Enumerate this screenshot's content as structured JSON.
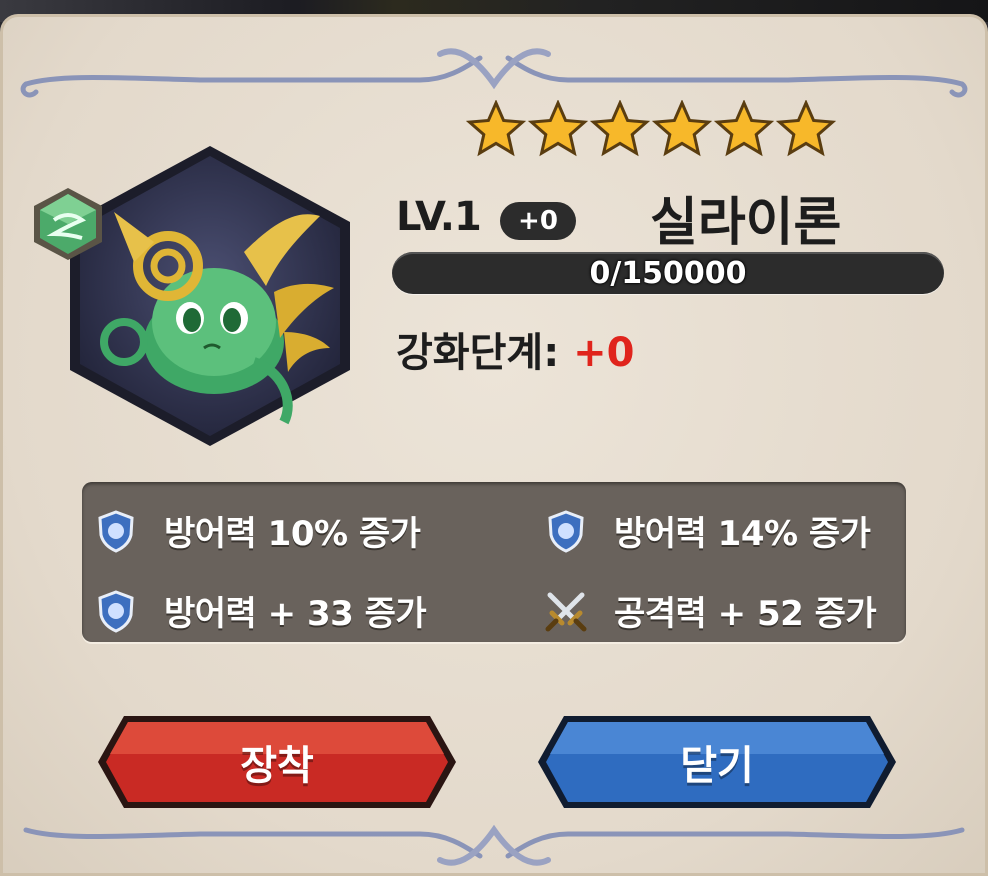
{
  "card": {
    "stars": 6,
    "level_label": "LV.1",
    "plus_badge": "+0",
    "name": "실라이론",
    "exp_text": "0/150000",
    "exp_progress": 0,
    "enhance_label": "강화단계:",
    "enhance_value": "+0"
  },
  "stats": [
    {
      "icon": "shield-icon",
      "text": "방어력 10% 증가"
    },
    {
      "icon": "shield-icon",
      "text": "방어력 14% 증가"
    },
    {
      "icon": "shield-icon",
      "text": "방어력 + 33 증가"
    },
    {
      "icon": "crossed-swords-icon",
      "text": "공격력 + 52 증가"
    }
  ],
  "buttons": {
    "equip_label": "장착",
    "close_label": "닫기"
  },
  "colors": {
    "panel": "#e6ddd0",
    "equip_button": "#c92a24",
    "close_button": "#2f6cc0",
    "enhance_value": "#e0241c",
    "star": "#f7b82a"
  }
}
